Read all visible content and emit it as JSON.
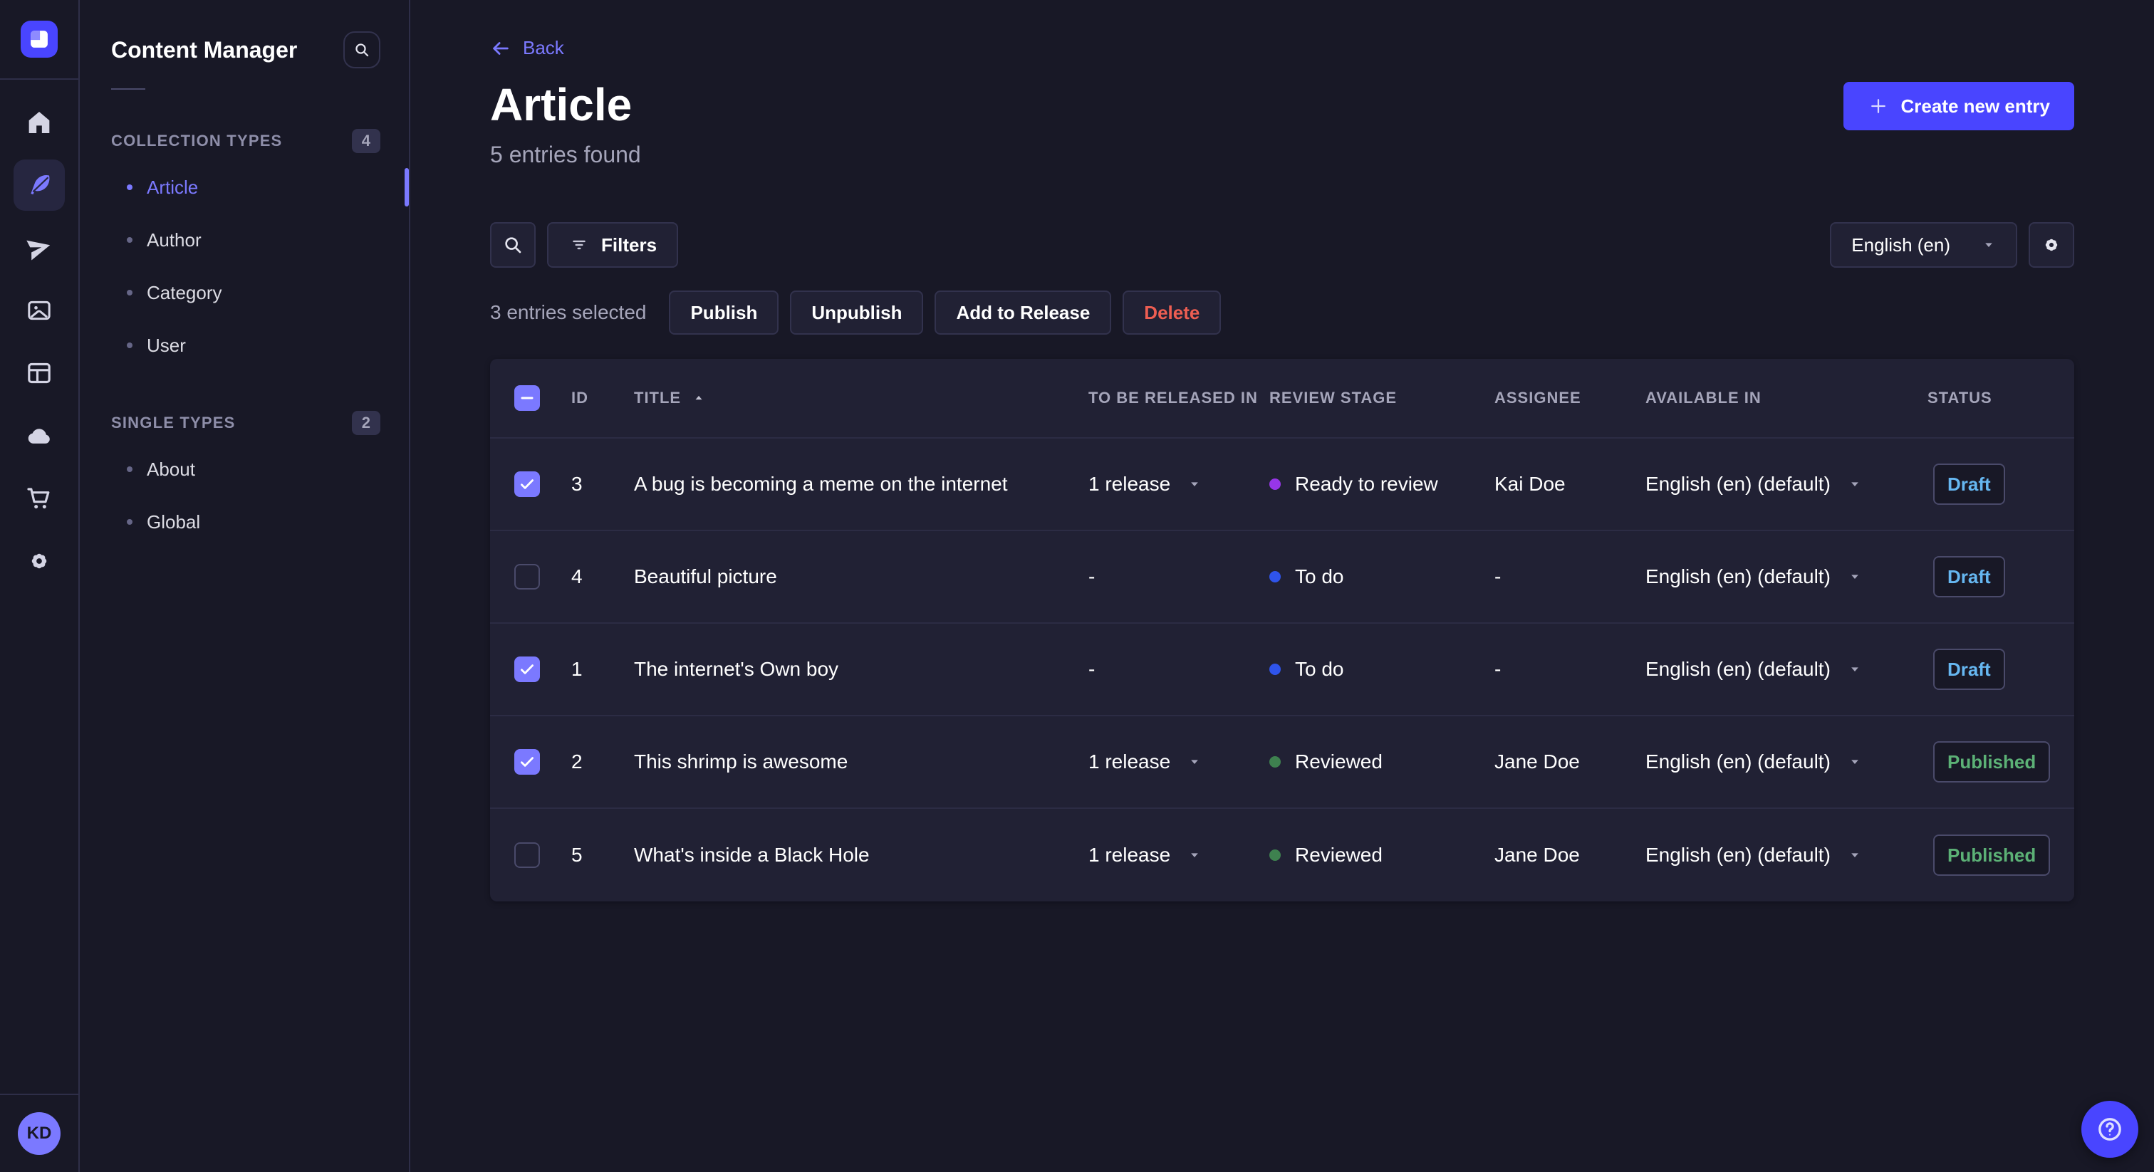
{
  "colors": {
    "primary": "#4945ff",
    "primary_light": "#7b79ff",
    "danger": "#ee5e52",
    "draft_text": "#66b7f1",
    "published_text": "#5cb176"
  },
  "nav_rail": {
    "logo_icon": "strapi-logo-icon",
    "items": [
      {
        "icon": "home-icon",
        "active": false
      },
      {
        "icon": "feather-icon",
        "active": true
      },
      {
        "icon": "paper-plane-icon",
        "active": false
      },
      {
        "icon": "images-icon",
        "active": false
      },
      {
        "icon": "layout-icon",
        "active": false
      },
      {
        "icon": "cloud-icon",
        "active": false
      },
      {
        "icon": "cart-icon",
        "active": false
      },
      {
        "icon": "gear-icon",
        "active": false
      }
    ],
    "avatar_initials": "KD"
  },
  "subnav": {
    "title": "Content Manager",
    "search_icon": "search-icon",
    "sections": [
      {
        "label": "COLLECTION TYPES",
        "count": "4",
        "items": [
          {
            "label": "Article",
            "active": true
          },
          {
            "label": "Author",
            "active": false
          },
          {
            "label": "Category",
            "active": false
          },
          {
            "label": "User",
            "active": false
          }
        ]
      },
      {
        "label": "SINGLE TYPES",
        "count": "2",
        "items": [
          {
            "label": "About",
            "active": false
          },
          {
            "label": "Global",
            "active": false
          }
        ]
      }
    ]
  },
  "header": {
    "back_label": "Back",
    "back_icon": "arrow-left-icon",
    "title": "Article",
    "subtitle": "5 entries found",
    "create_label": "Create new entry",
    "create_icon": "plus-icon"
  },
  "toolbar": {
    "search_icon": "search-icon",
    "filter_icon": "filter-icon",
    "filters_label": "Filters",
    "locale_value": "English (en)",
    "locale_caret_icon": "caret-down-icon",
    "settings_icon": "gear-icon"
  },
  "selection": {
    "text": "3 entries selected",
    "actions": [
      {
        "label": "Publish",
        "danger": false
      },
      {
        "label": "Unpublish",
        "danger": false
      },
      {
        "label": "Add to Release",
        "danger": false
      },
      {
        "label": "Delete",
        "danger": true
      }
    ]
  },
  "table": {
    "sort_icon": "sort-asc-icon",
    "caret_icon": "caret-down-icon",
    "columns": {
      "id": "ID",
      "title": "TITLE",
      "release": "TO BE RELEASED IN",
      "stage": "REVIEW STAGE",
      "assignee": "ASSIGNEE",
      "available": "AVAILABLE IN",
      "status": "STATUS"
    },
    "rows": [
      {
        "checked": true,
        "id": "3",
        "title": "A bug is becoming a meme on the internet",
        "release": "1 release",
        "has_release": true,
        "stage": "Ready to review",
        "stage_color": "#9736e8",
        "assignee": "Kai Doe",
        "locale": "English (en) (default)",
        "status": "Draft",
        "status_color": "#66b7f1"
      },
      {
        "checked": false,
        "id": "4",
        "title": "Beautiful picture",
        "release": "-",
        "has_release": false,
        "stage": "To do",
        "stage_color": "#2f54eb",
        "assignee": "-",
        "locale": "English (en) (default)",
        "status": "Draft",
        "status_color": "#66b7f1"
      },
      {
        "checked": true,
        "id": "1",
        "title": "The internet's Own boy",
        "release": "-",
        "has_release": false,
        "stage": "To do",
        "stage_color": "#2f54eb",
        "assignee": "-",
        "locale": "English (en) (default)",
        "status": "Draft",
        "status_color": "#66b7f1"
      },
      {
        "checked": true,
        "id": "2",
        "title": "This shrimp is awesome",
        "release": "1 release",
        "has_release": true,
        "stage": "Reviewed",
        "stage_color": "#3e814f",
        "assignee": "Jane Doe",
        "locale": "English (en) (default)",
        "status": "Published",
        "status_color": "#5cb176"
      },
      {
        "checked": false,
        "id": "5",
        "title": "What's inside a Black Hole",
        "release": "1 release",
        "has_release": true,
        "stage": "Reviewed",
        "stage_color": "#3e814f",
        "assignee": "Jane Doe",
        "locale": "English (en) (default)",
        "status": "Published",
        "status_color": "#5cb176"
      }
    ]
  },
  "fab": {
    "icon": "help-icon"
  }
}
